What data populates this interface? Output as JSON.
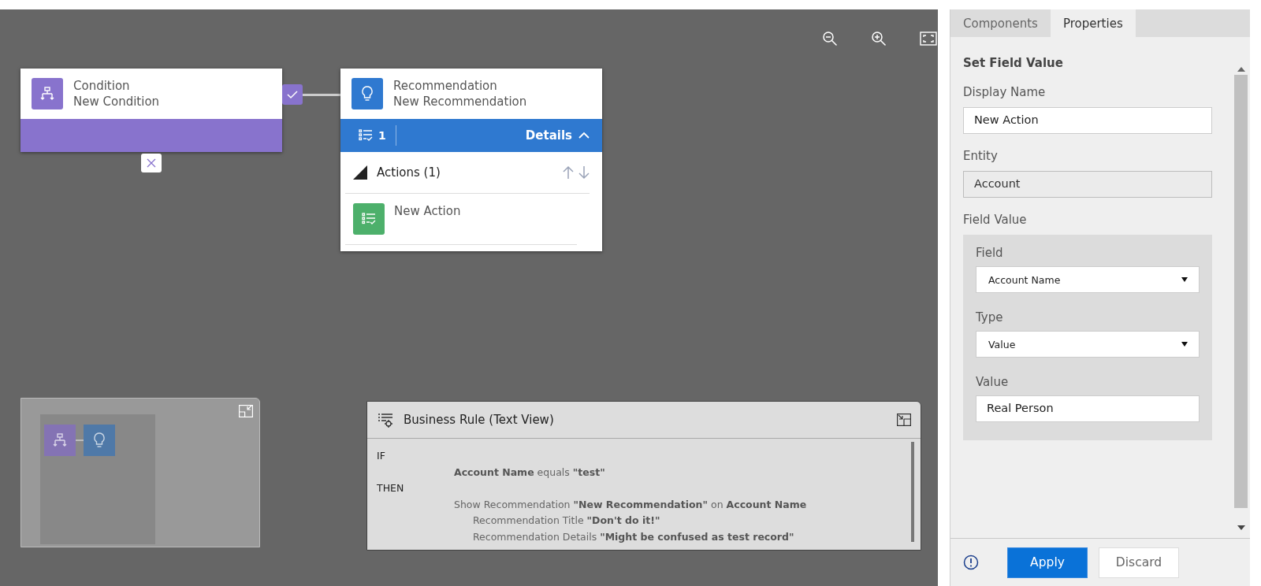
{
  "canvas": {
    "nodes": [
      {
        "kind": "condition",
        "type_label": "Condition",
        "name": "New Condition"
      },
      {
        "kind": "recommendation",
        "type_label": "Recommendation",
        "name": "New Recommendation",
        "action_count": "1",
        "details_label": "Details",
        "expanded": true,
        "section": {
          "label": "Actions (1)",
          "expanded": true,
          "items": [
            {
              "name": "New Action"
            }
          ]
        }
      }
    ]
  },
  "text_view": {
    "title": "Business Rule (Text View)",
    "lines": [
      {
        "keyword": "IF",
        "children": [
          {
            "text": "**Account Name** equals **\"test\"**"
          }
        ]
      },
      {
        "keyword": "THEN",
        "children": [
          {
            "text": "Show Recommendation **\"New Recommendation\"** on **Account Name**",
            "children": [
              {
                "text": "Recommendation Title **\"Don't do it!\"**"
              },
              {
                "text": "Recommendation Details **\"Might be confused as test record\"**"
              }
            ]
          }
        ]
      }
    ]
  },
  "panel": {
    "tabs": [
      {
        "label": "Components",
        "selected": false
      },
      {
        "label": "Properties",
        "selected": true
      }
    ],
    "heading": "Set Field Value",
    "fields": [
      {
        "kind": "input",
        "label": "Display Name",
        "value": "New Action",
        "disabled": false
      },
      {
        "kind": "input",
        "label": "Entity",
        "value": "Account",
        "disabled": true
      }
    ],
    "group": {
      "label": "Field Value",
      "fields": [
        {
          "kind": "select",
          "label": "Field",
          "value": "Account Name"
        },
        {
          "kind": "select",
          "label": "Type",
          "value": "Value"
        },
        {
          "kind": "input",
          "label": "Value",
          "value": "Real Person",
          "disabled": false
        }
      ]
    },
    "buttons": [
      {
        "label": "Apply",
        "primary": true
      },
      {
        "label": "Discard",
        "primary": false
      }
    ]
  }
}
